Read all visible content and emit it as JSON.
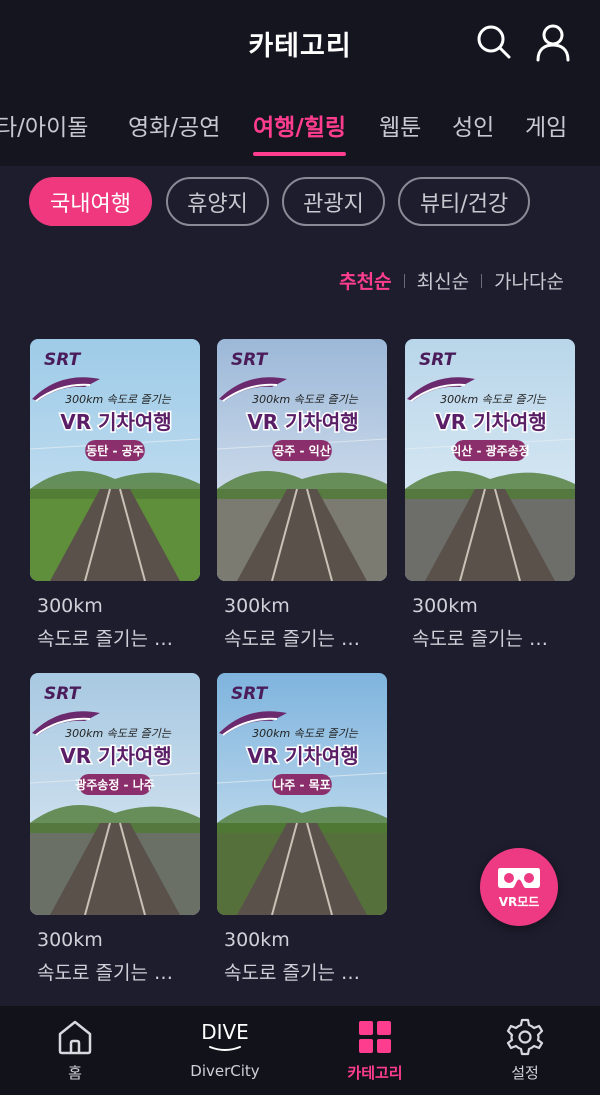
{
  "header": {
    "title": "카테고리",
    "icons": [
      "search-icon",
      "profile-icon"
    ]
  },
  "tabs": [
    {
      "label": "스타/아이돌",
      "display": "타/아이돌"
    },
    {
      "label": "영화/공연"
    },
    {
      "label": "여행/힐링",
      "active": true
    },
    {
      "label": "웹툰"
    },
    {
      "label": "성인"
    },
    {
      "label": "게임"
    }
  ],
  "chips": [
    {
      "label": "국내여행",
      "active": true
    },
    {
      "label": "휴양지"
    },
    {
      "label": "관광지"
    },
    {
      "label": "뷰티/건강"
    }
  ],
  "sort": {
    "options": [
      "추천순",
      "최신순",
      "가나다순"
    ],
    "active": "추천순"
  },
  "cards": [
    {
      "brand": "SRT",
      "tagline": "300km 속도로 즐기는",
      "headline": "VR 기차여행",
      "route": "동탄 - 공주",
      "title_line1": "300km",
      "title_line2": "속도로 즐기는 …"
    },
    {
      "brand": "SRT",
      "tagline": "300km 속도로 즐기는",
      "headline": "VR 기차여행",
      "route": "공주 - 익산",
      "title_line1": "300km",
      "title_line2": "속도로 즐기는 …"
    },
    {
      "brand": "SRT",
      "tagline": "300km 속도로 즐기는",
      "headline": "VR 기차여행",
      "route": "익산 - 광주송정",
      "title_line1": "300km",
      "title_line2": "속도로 즐기는 …"
    },
    {
      "brand": "SRT",
      "tagline": "300km 속도로 즐기는",
      "headline": "VR 기차여행",
      "route": "광주송정 - 나주",
      "title_line1": "300km",
      "title_line2": "속도로 즐기는 …"
    },
    {
      "brand": "SRT",
      "tagline": "300km 속도로 즐기는",
      "headline": "VR 기차여행",
      "route": "나주 - 목포",
      "title_line1": "300km",
      "title_line2": "속도로 즐기는 …"
    }
  ],
  "vr_button": {
    "label": "VR모드",
    "icon": "vr-headset-icon"
  },
  "bottom_nav": [
    {
      "label": "홈",
      "icon": "home-icon"
    },
    {
      "label": "DiverCity",
      "icon": "dive-logo",
      "logo_text": "DIVE"
    },
    {
      "label": "카테고리",
      "icon": "grid-icon",
      "active": true
    },
    {
      "label": "설정",
      "icon": "gear-icon"
    }
  ],
  "colors": {
    "accent": "#ff3d8f",
    "background": "#1e1d2e",
    "header_bg": "#15151f",
    "badge_purple": "#8a2f6c"
  }
}
